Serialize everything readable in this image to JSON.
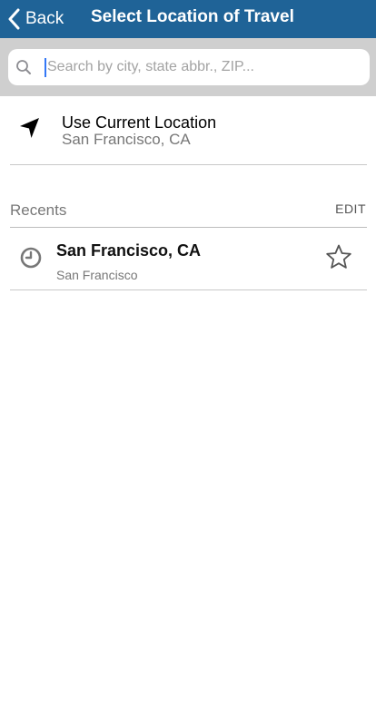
{
  "navbar": {
    "back_label": "Back",
    "title": "Select Location of Travel",
    "background_color": "#1f6397"
  },
  "search": {
    "value": "",
    "placeholder": "Search by city, state abbr., ZIP..."
  },
  "current_location": {
    "title": "Use Current Location",
    "subtitle": "San Francisco, CA",
    "icon": "location-arrow-icon"
  },
  "recents": {
    "label": "Recents",
    "edit_label": "EDIT",
    "items": [
      {
        "title": "San Francisco, CA",
        "subtitle": "San Francisco",
        "icon": "clock-icon",
        "favorite_icon": "star-outline-icon"
      }
    ]
  }
}
